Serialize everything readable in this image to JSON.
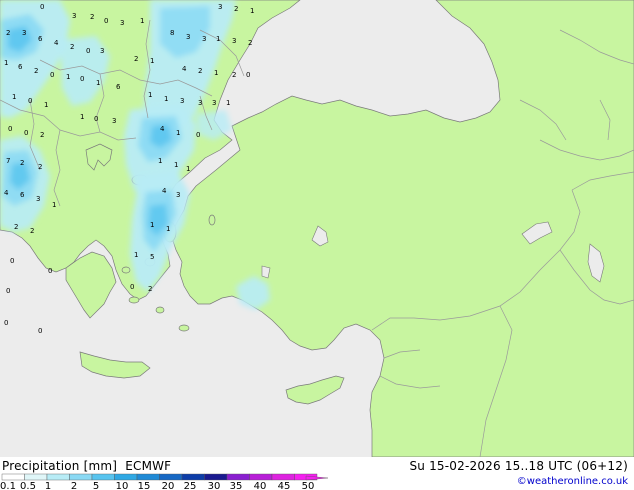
{
  "header": {
    "title": "Precipitation [mm]",
    "model": "ECMWF",
    "valid": "Su 15-02-2026 15..18 UTC (06+12)",
    "credit": "©weatheronline.co.uk"
  },
  "colors": {
    "sea": "#ececec",
    "land": "#c8f5a0",
    "border": "#9a9a9a",
    "coast": "#7a7a7a"
  },
  "legend": {
    "labels": [
      "0.1",
      "0.5",
      "1",
      "2",
      "5",
      "10",
      "15",
      "20",
      "25",
      "30",
      "35",
      "40",
      "45",
      "50"
    ],
    "colors": [
      "#ffffff",
      "#e0f6f8",
      "#b8ecf6",
      "#8ad9f4",
      "#58c4ef",
      "#2fa8e4",
      "#1f8ad6",
      "#1768c4",
      "#0d3da8",
      "#1a1a90",
      "#8a1fd0",
      "#b81fd8",
      "#de22e0",
      "#f51ff0"
    ]
  },
  "map_values": [
    {
      "v": "0"
    },
    {
      "v": "3"
    },
    {
      "v": "2"
    },
    {
      "v": "0"
    },
    {
      "v": "3"
    },
    {
      "v": "1"
    },
    {
      "v": "3"
    },
    {
      "v": "2"
    },
    {
      "v": "1"
    },
    {
      "v": "2"
    },
    {
      "v": "3"
    },
    {
      "v": "6"
    },
    {
      "v": "4"
    },
    {
      "v": "2"
    },
    {
      "v": "0"
    },
    {
      "v": "3"
    },
    {
      "v": "8"
    },
    {
      "v": "3"
    },
    {
      "v": "3"
    },
    {
      "v": "1"
    },
    {
      "v": "3"
    },
    {
      "v": "2"
    },
    {
      "v": "1"
    },
    {
      "v": "6"
    },
    {
      "v": "2"
    },
    {
      "v": "0"
    },
    {
      "v": "1"
    },
    {
      "v": "0"
    },
    {
      "v": "1"
    },
    {
      "v": "2"
    },
    {
      "v": "1"
    },
    {
      "v": "4"
    },
    {
      "v": "2"
    },
    {
      "v": "1"
    },
    {
      "v": "2"
    },
    {
      "v": "0"
    },
    {
      "v": "1"
    },
    {
      "v": "0"
    },
    {
      "v": "1"
    },
    {
      "v": "6"
    },
    {
      "v": "1"
    },
    {
      "v": "1"
    },
    {
      "v": "3"
    },
    {
      "v": "3"
    },
    {
      "v": "3"
    },
    {
      "v": "1"
    },
    {
      "v": "0"
    },
    {
      "v": "0"
    },
    {
      "v": "2"
    },
    {
      "v": "1"
    },
    {
      "v": "0"
    },
    {
      "v": "3"
    },
    {
      "v": "4"
    },
    {
      "v": "1"
    },
    {
      "v": "0"
    },
    {
      "v": "7"
    },
    {
      "v": "2"
    },
    {
      "v": "2"
    },
    {
      "v": "1"
    },
    {
      "v": "1"
    },
    {
      "v": "1"
    },
    {
      "v": "4"
    },
    {
      "v": "6"
    },
    {
      "v": "3"
    },
    {
      "v": "1"
    },
    {
      "v": "4"
    },
    {
      "v": "3"
    },
    {
      "v": "2"
    },
    {
      "v": "2"
    },
    {
      "v": "1"
    },
    {
      "v": "1"
    },
    {
      "v": "0"
    },
    {
      "v": "0"
    },
    {
      "v": "1"
    },
    {
      "v": "5"
    },
    {
      "v": "0"
    },
    {
      "v": "0"
    },
    {
      "v": "2"
    },
    {
      "v": "0"
    },
    {
      "v": "0"
    }
  ]
}
